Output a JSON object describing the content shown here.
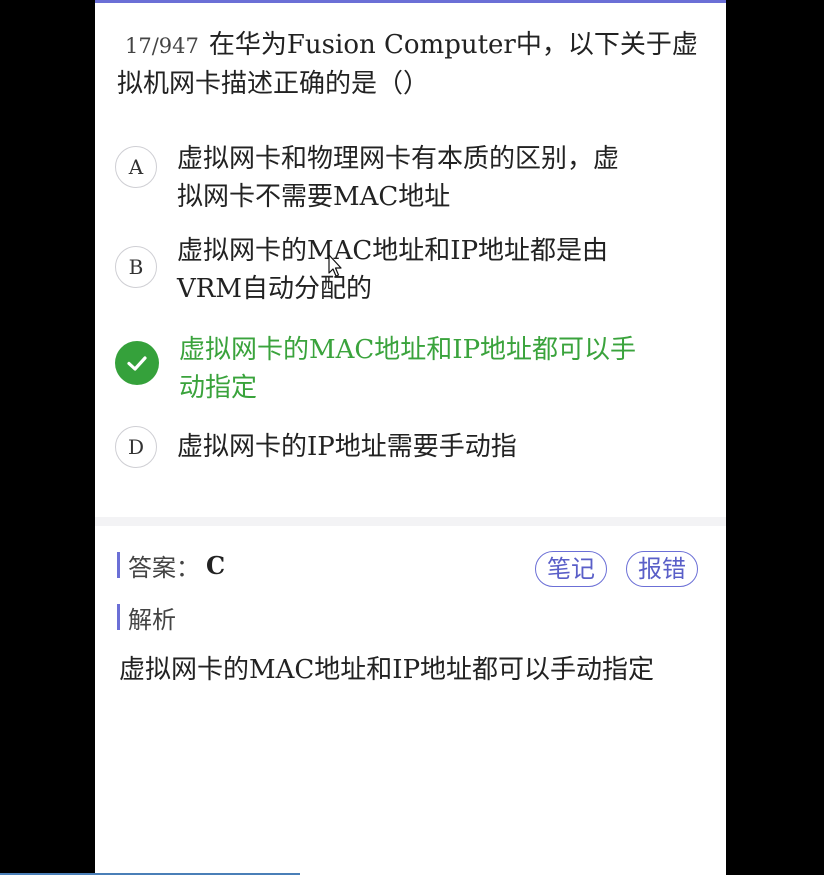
{
  "question": {
    "counter": "17/947",
    "text": "在华为Fusion Computer中，以下关于虚拟机网卡描述正确的是（）"
  },
  "options": [
    {
      "letter": "A",
      "text": "虚拟网卡和物理网卡有本质的区别，虚拟网卡不需要MAC地址",
      "correct": false
    },
    {
      "letter": "B",
      "text": "虚拟网卡的MAC地址和IP地址都是由VRM自动分配的",
      "correct": false
    },
    {
      "letter": "C",
      "text": "虚拟网卡的MAC地址和IP地址都可以手动指定",
      "correct": true
    },
    {
      "letter": "D",
      "text": "虚拟网卡的IP地址需要手动指",
      "correct": false
    }
  ],
  "answer": {
    "label": "答案：",
    "value": "C"
  },
  "buttons": {
    "notes": "笔记",
    "report": "报错"
  },
  "analysis": {
    "title": "解析",
    "text": "虚拟网卡的MAC地址和IP地址都可以手动指定"
  },
  "colors": {
    "accent": "#6b6fd6",
    "correct": "#35a13b",
    "background": "#000000"
  },
  "icons": {
    "correct_option": "check-icon",
    "pointer": "mouse-cursor-icon"
  }
}
